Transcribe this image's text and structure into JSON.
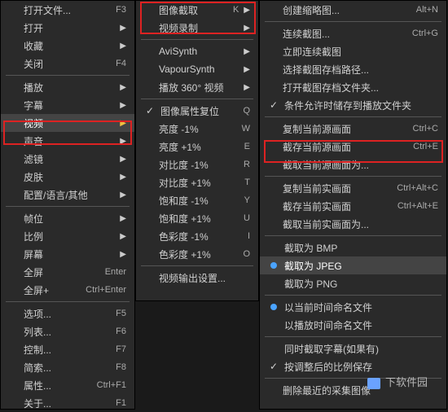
{
  "col1": {
    "items": [
      {
        "label": "打开文件...",
        "shortcut": "F3"
      },
      {
        "label": "打开",
        "arrow": true
      },
      {
        "label": "收藏",
        "arrow": true
      },
      {
        "label": "关闭",
        "shortcut": "F4"
      },
      {
        "sep": true
      },
      {
        "label": "播放",
        "arrow": true
      },
      {
        "label": "字幕",
        "arrow": true
      },
      {
        "label": "视频",
        "arrow": true,
        "highlight": true,
        "yellowArrow": true
      },
      {
        "label": "声音",
        "arrow": true
      },
      {
        "label": "滤镜",
        "arrow": true
      },
      {
        "label": "皮肤",
        "arrow": true
      },
      {
        "label": "配置/语言/其他",
        "arrow": true
      },
      {
        "sep": true
      },
      {
        "label": "帧位",
        "arrow": true
      },
      {
        "label": "比例",
        "arrow": true
      },
      {
        "label": "屏幕",
        "arrow": true
      },
      {
        "label": "全屏",
        "shortcut": "Enter"
      },
      {
        "label": "全屏+",
        "shortcut": "Ctrl+Enter"
      },
      {
        "sep": true
      },
      {
        "label": "选项...",
        "shortcut": "F5"
      },
      {
        "label": "列表...",
        "shortcut": "F6"
      },
      {
        "label": "控制...",
        "shortcut": "F7"
      },
      {
        "label": "简索...",
        "shortcut": "F8"
      },
      {
        "label": "属性...",
        "shortcut": "Ctrl+F1"
      },
      {
        "label": "关于...",
        "shortcut": "F1"
      }
    ]
  },
  "col2": {
    "items": [
      {
        "label": "图像截取",
        "shortcut": "K",
        "arrow": true
      },
      {
        "label": "视频录制",
        "arrow": true
      },
      {
        "sep": true
      },
      {
        "label": "AviSynth",
        "arrow": true
      },
      {
        "label": "VapourSynth",
        "arrow": true
      },
      {
        "label": "播放 360° 视频",
        "arrow": true
      },
      {
        "sep": true
      },
      {
        "label": "图像属性复位",
        "shortcut": "Q",
        "check": true
      },
      {
        "label": "亮度 -1%",
        "shortcut": "W"
      },
      {
        "label": "亮度 +1%",
        "shortcut": "E"
      },
      {
        "label": "对比度 -1%",
        "shortcut": "R"
      },
      {
        "label": "对比度 +1%",
        "shortcut": "T"
      },
      {
        "label": "饱和度 -1%",
        "shortcut": "Y"
      },
      {
        "label": "饱和度 +1%",
        "shortcut": "U"
      },
      {
        "label": "色彩度 -1%",
        "shortcut": "I"
      },
      {
        "label": "色彩度 +1%",
        "shortcut": "O"
      },
      {
        "sep": true
      },
      {
        "label": "视频输出设置...",
        "shortcut": ""
      }
    ]
  },
  "col3": {
    "items": [
      {
        "label": "创建缩略图...",
        "shortcut": "Alt+N"
      },
      {
        "sep": true
      },
      {
        "label": "连续截图...",
        "shortcut": "Ctrl+G"
      },
      {
        "label": "立即连续截图"
      },
      {
        "label": "选择截图存档路径..."
      },
      {
        "label": "打开截图存档文件夹..."
      },
      {
        "label": "条件允许时储存到播放文件夹",
        "check": true
      },
      {
        "sep": true
      },
      {
        "label": "复制当前源画面",
        "shortcut": "Ctrl+C"
      },
      {
        "label": "截存当前源画面",
        "shortcut": "Ctrl+E"
      },
      {
        "label": "截取当前源画面为..."
      },
      {
        "sep": true
      },
      {
        "label": "复制当前实画面",
        "shortcut": "Ctrl+Alt+C"
      },
      {
        "label": "截存当前实画面",
        "shortcut": "Ctrl+Alt+E"
      },
      {
        "label": "截取当前实画面为..."
      },
      {
        "sep": true
      },
      {
        "label": "截取为 BMP",
        "radio": false
      },
      {
        "label": "截取为 JPEG",
        "radio": true,
        "highlight": true
      },
      {
        "label": "截取为 PNG",
        "radio": false
      },
      {
        "sep": true
      },
      {
        "label": "以当前时间命名文件",
        "radio": true
      },
      {
        "label": "以播放时间命名文件",
        "radio": false
      },
      {
        "sep": true
      },
      {
        "label": "同时截取字幕(如果有)",
        "check": false
      },
      {
        "label": "按调整后的比例保存",
        "check": true
      },
      {
        "sep": true
      },
      {
        "label": "删除最近的采集图像"
      }
    ]
  },
  "watermark": "下软件园"
}
